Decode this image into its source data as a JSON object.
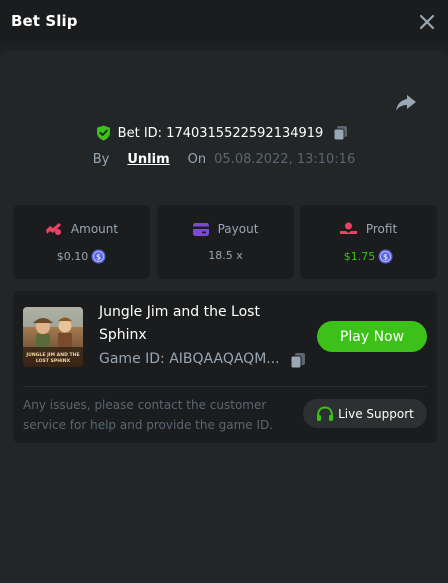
{
  "header": {
    "title": "Bet Slip",
    "close_icon": "close-icon"
  },
  "bet": {
    "id_label": "Bet ID: 1740315522592134919",
    "by_label": "By",
    "user": "Unlim",
    "on_label": "On",
    "datetime": "05.08.2022, 13:10:16"
  },
  "stats": {
    "amount": {
      "label": "Amount",
      "value": "$0.10"
    },
    "payout": {
      "label": "Payout",
      "value": "18.5 x"
    },
    "profit": {
      "label": "Profit",
      "value": "$1.75"
    }
  },
  "game": {
    "title": "Jungle Jim and the Lost Sphinx",
    "id_text": "Game ID: AIBQAAQAQM...",
    "thumb_text_line1": "JUNGLE JIM AND THE",
    "thumb_text_line2": "LOST SPHINX",
    "play_label": "Play Now",
    "issue_text": "Any issues, please contact the customer service for help and provide the game ID.",
    "support_label": "Live Support"
  },
  "colors": {
    "accent_green": "#3bc117",
    "background": "#1e2021",
    "card": "#1a1c1d",
    "muted_text": "#98a7b5",
    "amount_icon": "#ed4163",
    "payout_icon": "#7b4bd8",
    "profit_icon": "#ed4163",
    "coin": "#5a66e0"
  }
}
